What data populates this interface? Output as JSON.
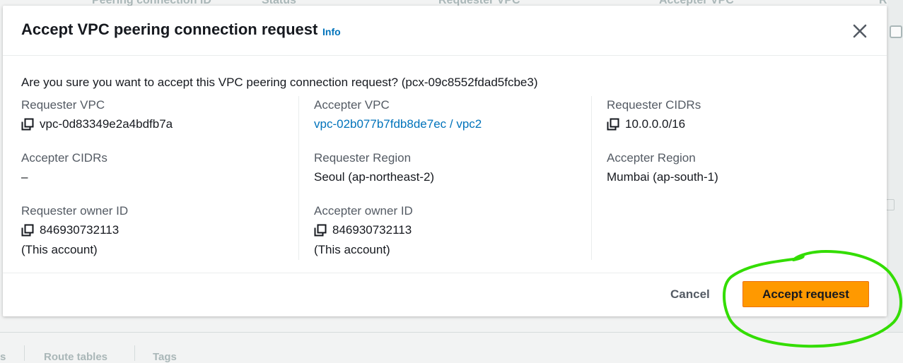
{
  "background": {
    "header_columns": [
      "Peering connection ID",
      "Status",
      "Requester VPC",
      "Accepter VPC",
      "Req"
    ],
    "tabs": [
      "s",
      "Route tables",
      "Tags"
    ]
  },
  "modal": {
    "title": "Accept VPC peering connection request",
    "info_label": "Info",
    "confirm_text": "Are you sure you want to accept this VPC peering connection request? (pcx-09c8552fdad5fcbe3)",
    "fields": {
      "requester_vpc": {
        "label": "Requester VPC",
        "value": "vpc-0d83349e2a4bdfb7a"
      },
      "accepter_vpc": {
        "label": "Accepter VPC",
        "value": "vpc-02b077b7fdb8de7ec / vpc2"
      },
      "requester_cidrs": {
        "label": "Requester CIDRs",
        "value": "10.0.0.0/16"
      },
      "accepter_cidrs": {
        "label": "Accepter CIDRs",
        "value": "–"
      },
      "requester_region": {
        "label": "Requester Region",
        "value": "Seoul (ap-northeast-2)"
      },
      "accepter_region": {
        "label": "Accepter Region",
        "value": "Mumbai (ap-south-1)"
      },
      "requester_owner": {
        "label": "Requester owner ID",
        "value": "846930732113",
        "note": "(This account)"
      },
      "accepter_owner": {
        "label": "Accepter owner ID",
        "value": "846930732113",
        "note": "(This account)"
      }
    },
    "cancel_label": "Cancel",
    "accept_label": "Accept request"
  },
  "colors": {
    "accent_orange": "#ff9900",
    "link_blue": "#0073bb",
    "annotation_green": "#33dd00"
  },
  "icons": [
    "copy-icon",
    "close-icon"
  ]
}
